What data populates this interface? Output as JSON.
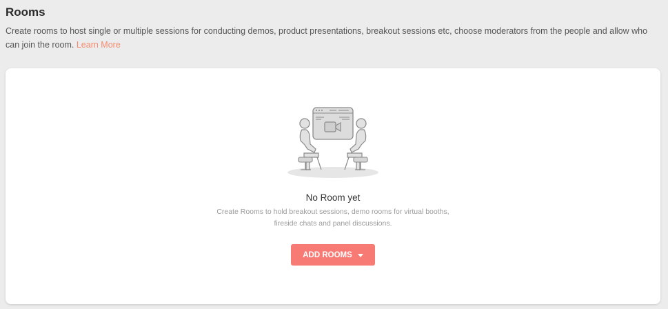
{
  "header": {
    "title": "Rooms",
    "description": "Create rooms to host single or multiple sessions for conducting demos, product presentations, breakout sessions etc, choose moderators from the people and allow who can join the room.",
    "learn_more": "Learn More"
  },
  "empty_state": {
    "title": "No Room yet",
    "description_line1": "Create Rooms to hold breakout sessions, demo rooms for virtual booths,",
    "description_line2": "fireside chats and panel discussions.",
    "illustration": "video-meeting-illustration"
  },
  "actions": {
    "add_rooms_label": "ADD ROOMS",
    "add_rooms_icon": "caret-down-icon"
  },
  "colors": {
    "accent": "#f77b74",
    "link": "#f58a6e",
    "background": "#ececec"
  }
}
